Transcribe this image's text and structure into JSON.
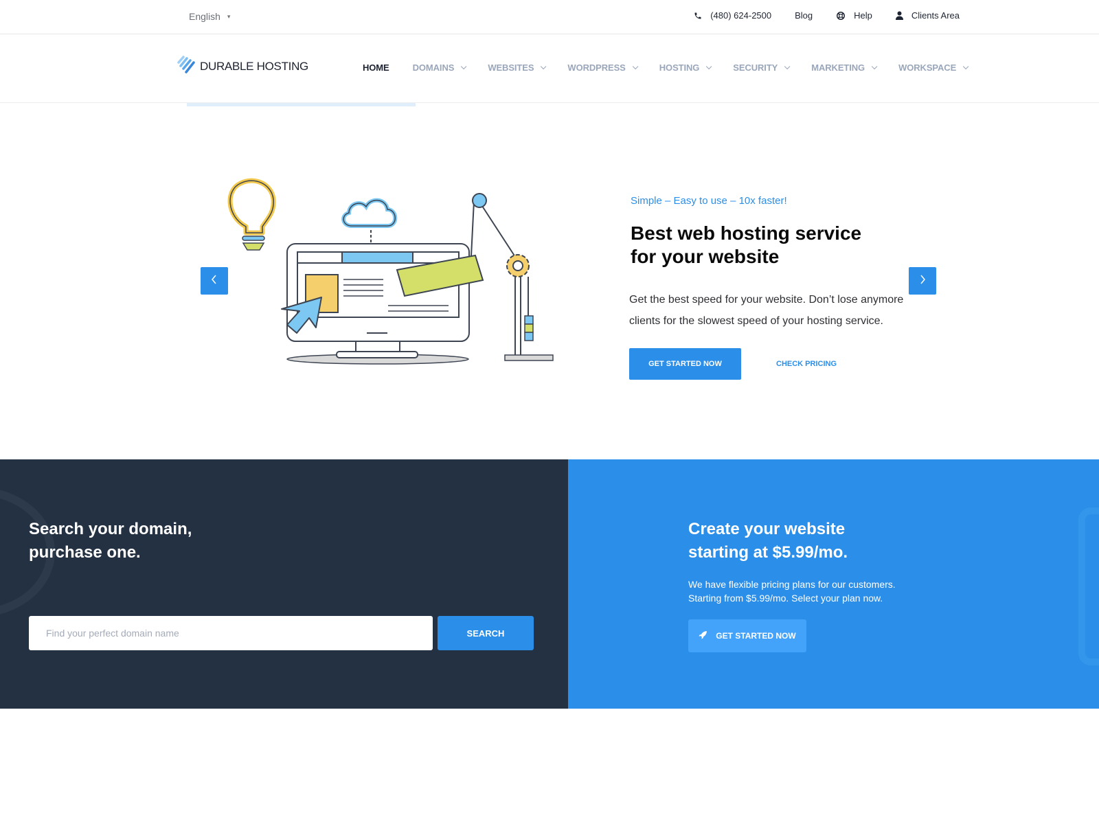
{
  "topbar": {
    "language": "English",
    "phone": "(480) 624-2500",
    "blog": "Blog",
    "help": "Help",
    "clients_area": "Clients Area"
  },
  "navbar": {
    "logo_text": "DURABLE HOSTING",
    "items": [
      {
        "label": "HOME",
        "active": true,
        "dropdown": false
      },
      {
        "label": "DOMAINS",
        "dropdown": true
      },
      {
        "label": "WEBSITES",
        "dropdown": true
      },
      {
        "label": "WORDPRESS",
        "dropdown": true
      },
      {
        "label": "HOSTING",
        "dropdown": true
      },
      {
        "label": "SECURITY",
        "dropdown": true
      },
      {
        "label": "MARKETING",
        "dropdown": true
      },
      {
        "label": "WORKSPACE",
        "dropdown": true
      }
    ]
  },
  "hero": {
    "tagline": "Simple – Easy to use – 10x faster!",
    "title_line1": "Best web hosting service",
    "title_line2": "for your website",
    "desc_line1": "Get the best speed for your website. Don’t lose anymore",
    "desc_line2": "clients for the slowest speed of your hosting service.",
    "primary_button": "GET STARTED NOW",
    "secondary_button": "CHECK PRICING",
    "prev_icon": "chevron-left-icon",
    "next_icon": "chevron-right-icon"
  },
  "domain_search": {
    "title_line1": "Search your domain,",
    "title_line2": "purchase one.",
    "input_value": "",
    "input_placeholder": "Find your perfect domain name",
    "button": "SEARCH"
  },
  "website_promo": {
    "title_line1": "Create your website",
    "title_line2": "starting at $5.99/mo.",
    "desc_line1": "We have flexible pricing plans for our customers.",
    "desc_line2": "Starting from $5.99/mo. Select your plan now.",
    "button": "GET STARTED NOW",
    "button_icon": "rocket-icon"
  },
  "colors": {
    "accent": "#2b8ee8",
    "dark_panel": "#243142",
    "nav_inactive": "#9aa6ba",
    "nav_active": "#1c2130"
  }
}
